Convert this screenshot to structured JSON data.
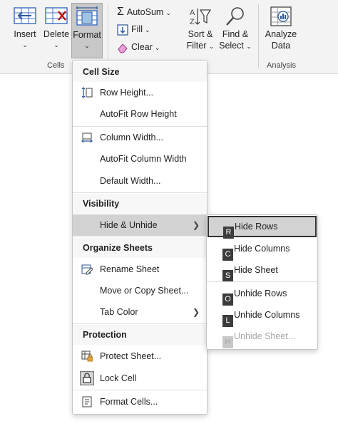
{
  "ribbon": {
    "insert_label": "Insert",
    "delete_label": "Delete",
    "format_label": "Format",
    "cells_group_label": "Cells",
    "autosum_label": "AutoSum",
    "fill_label": "Fill",
    "clear_label": "Clear",
    "sort_filter_label_1": "Sort &",
    "sort_filter_label_2": "Filter",
    "find_select_label_1": "Find &",
    "find_select_label_2": "Select",
    "analyze_label_1": "Analyze",
    "analyze_label_2": "Data",
    "analysis_group_label": "Analysis",
    "accent_color": "#4472c4",
    "delete_color": "#c00000"
  },
  "format_menu": {
    "cell_size_header": "Cell Size",
    "row_height": "Row Height...",
    "autofit_row_height": "AutoFit Row Height",
    "column_width": "Column Width...",
    "autofit_column_width": "AutoFit Column Width",
    "default_width": "Default Width...",
    "visibility_header": "Visibility",
    "hide_unhide": "Hide & Unhide",
    "organize_header": "Organize Sheets",
    "rename_sheet": "Rename Sheet",
    "move_copy_sheet": "Move or Copy Sheet...",
    "tab_color": "Tab Color",
    "protection_header": "Protection",
    "protect_sheet": "Protect Sheet...",
    "lock_cell": "Lock Cell",
    "format_cells": "Format Cells..."
  },
  "hide_unhide_submenu": {
    "items": [
      {
        "key": "R",
        "label": "Hide Rows"
      },
      {
        "key": "C",
        "label": "Hide Columns"
      },
      {
        "key": "S",
        "label": "Hide Sheet"
      },
      {
        "key": "O",
        "label": "Unhide Rows"
      },
      {
        "key": "L",
        "label": "Unhide Columns"
      },
      {
        "key": "H",
        "label": "Unhide Sheet..."
      }
    ]
  }
}
